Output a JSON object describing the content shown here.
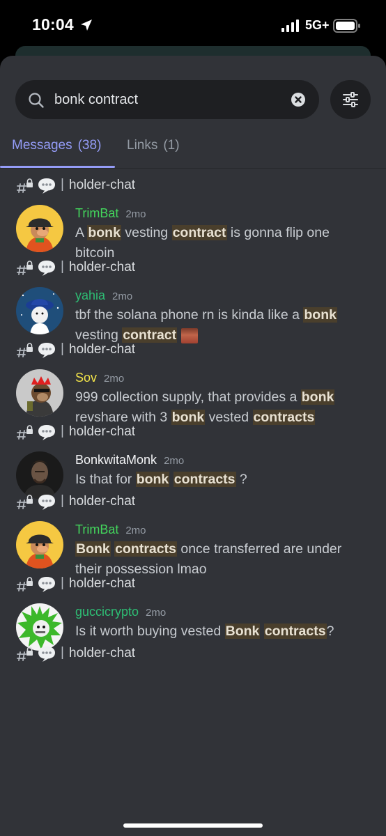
{
  "status_bar": {
    "time": "10:04",
    "network": "5G+"
  },
  "search": {
    "query": "bonk contract"
  },
  "tabs": [
    {
      "label": "Messages",
      "count": "(38)"
    },
    {
      "label": "Links",
      "count": "(1)"
    }
  ],
  "colors": {
    "accent": "#949cf7",
    "highlight": "#4a3f2c",
    "background": "#313338"
  },
  "results": [
    {
      "channel": "holder-chat",
      "author": "TrimBat",
      "author_color": "#43d65c",
      "time": "2mo",
      "segments": [
        {
          "t": "A "
        },
        {
          "t": "bonk",
          "h": true
        },
        {
          "t": " vesting "
        },
        {
          "t": "contract",
          "h": true
        },
        {
          "t": " is gonna flip one bitcoin"
        }
      ]
    },
    {
      "channel": "holder-chat",
      "author": "yahia",
      "author_color": "#2ebd74",
      "time": "2mo",
      "segments": [
        {
          "t": "tbf the solana phone rn is kinda like a "
        },
        {
          "t": "bonk",
          "h": true
        },
        {
          "t": " vesting "
        },
        {
          "t": "contract",
          "h": true
        },
        {
          "t": " "
        },
        {
          "emoji": true
        }
      ]
    },
    {
      "channel": "holder-chat",
      "author": "Sov",
      "author_color": "#f3e54a",
      "time": "2mo",
      "segments": [
        {
          "t": "999 collection supply, that provides a "
        },
        {
          "t": "bonk",
          "h": true
        },
        {
          "t": " revshare with 3 "
        },
        {
          "t": "bonk",
          "h": true
        },
        {
          "t": " vested "
        },
        {
          "t": "contracts",
          "h": true
        }
      ]
    },
    {
      "channel": "holder-chat",
      "author": "BonkwitaMonk",
      "author_color": "#f2f3f5",
      "time": "2mo",
      "segments": [
        {
          "t": "Is that for "
        },
        {
          "t": "bonk",
          "h": true
        },
        {
          "t": " "
        },
        {
          "t": "contracts",
          "h": true
        },
        {
          "t": " ?"
        }
      ]
    },
    {
      "channel": "holder-chat",
      "author": "TrimBat",
      "author_color": "#43d65c",
      "time": "2mo",
      "segments": [
        {
          "t": "Bonk",
          "h": true
        },
        {
          "t": " "
        },
        {
          "t": "contracts",
          "h": true
        },
        {
          "t": " once transferred are under their possession lmao"
        }
      ]
    },
    {
      "channel": "holder-chat",
      "author": "guccicrypto",
      "author_color": "#2ebd74",
      "time": "2mo",
      "segments": [
        {
          "t": "Is it worth buying vested "
        },
        {
          "t": "Bonk",
          "h": true
        },
        {
          "t": " "
        },
        {
          "t": "contracts",
          "h": true
        },
        {
          "t": "?"
        }
      ]
    },
    {
      "channel": "holder-chat"
    }
  ]
}
